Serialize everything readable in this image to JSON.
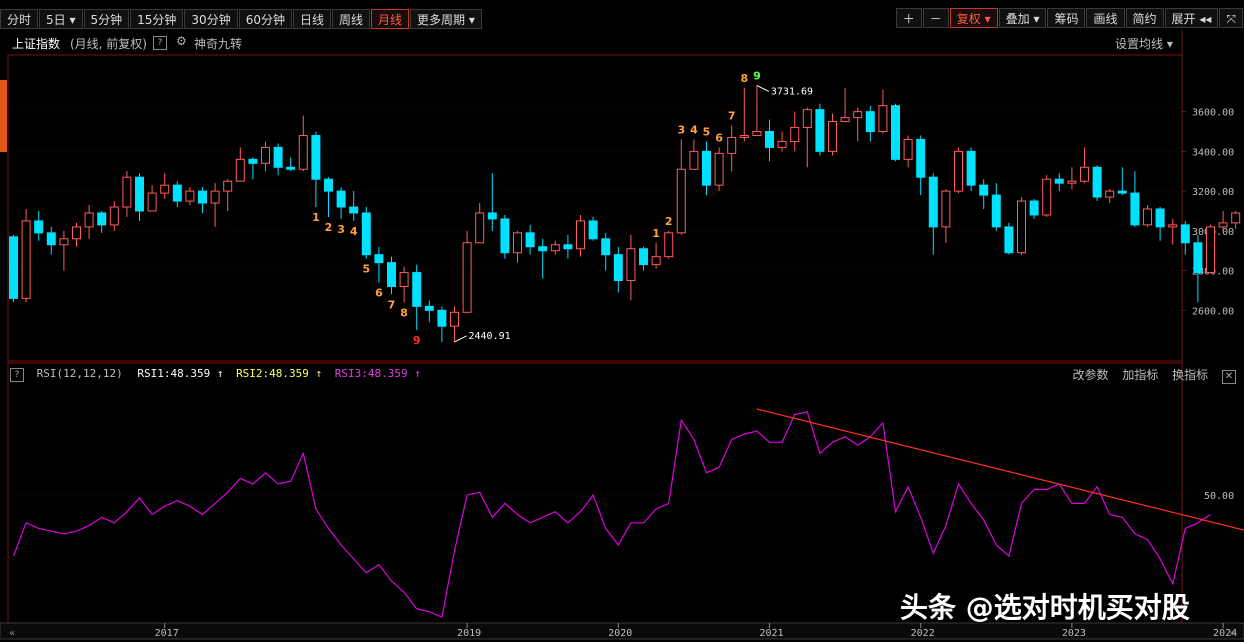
{
  "toolbar": {
    "items": [
      {
        "label": "分时"
      },
      {
        "label": "5日 ▾"
      },
      {
        "label": "5分钟"
      },
      {
        "label": "15分钟"
      },
      {
        "label": "30分钟"
      },
      {
        "label": "60分钟"
      },
      {
        "label": "日线"
      },
      {
        "label": "周线"
      },
      {
        "label": "月线"
      },
      {
        "label": "更多周期 ▾"
      }
    ],
    "active_index": 8,
    "right_items": [
      {
        "label": "＋"
      },
      {
        "label": "－"
      },
      {
        "label": "复权 ▾"
      },
      {
        "label": "叠加 ▾"
      },
      {
        "label": "筹码"
      },
      {
        "label": "画线"
      },
      {
        "label": "简约"
      },
      {
        "label": "展开 ◂◂"
      },
      {
        "label": "⤧"
      }
    ]
  },
  "title": {
    "name": "上证指数",
    "sub": "(月线, 前复权)",
    "indicator": "神奇九转",
    "ma_setting": "设置均线 ▾"
  },
  "rsi": {
    "header": "RSI(12,12,12)",
    "rsi1": "RSI1:48.359 ↑",
    "rsi2": "RSI2:48.359 ↑",
    "rsi3": "RSI3:48.359 ↑",
    "buttons": [
      "改参数",
      "加指标",
      "换指标"
    ],
    "close": "✕",
    "help": "?"
  },
  "colors": {
    "up": "#ff5c5c",
    "down": "#00e0ff",
    "rsi": "#e000e0",
    "trend": "#ff3020",
    "nine": "#ffa040",
    "nine_top": "#60ff60",
    "nine_bottom": "#ff3030"
  },
  "watermark": "头条 @选对时机买对股",
  "chart_data": {
    "type": "candlestick",
    "price_axis": {
      "ticks": [
        2600,
        2800,
        3000,
        3200,
        3400,
        3600
      ],
      "labels": [
        "2600.00",
        "2800.00",
        "3000.00",
        "3200.00",
        "3400.00",
        "3600.00"
      ],
      "range": [
        2360,
        3870
      ]
    },
    "rsi_axis": {
      "ticks": [
        50
      ],
      "labels": [
        "50.00"
      ],
      "range": [
        5,
        90
      ]
    },
    "year_labels": [
      {
        "year": "2017",
        "index": 12
      },
      {
        "year": "2019",
        "index": 36
      },
      {
        "year": "2020",
        "index": 48
      },
      {
        "year": "2021",
        "index": 60
      },
      {
        "year": "2022",
        "index": 72
      },
      {
        "year": "2023",
        "index": 84
      },
      {
        "year": "2024",
        "index": 96
      }
    ],
    "annotations": [
      {
        "text": "3731.69",
        "index": 59,
        "value": 3731.69
      },
      {
        "text": "2440.91",
        "index": 35,
        "value": 2440.91
      }
    ],
    "candles": [
      [
        2970,
        2660,
        2980,
        2640
      ],
      [
        2660,
        3050,
        3110,
        2640
      ],
      [
        3050,
        2990,
        3100,
        2950
      ],
      [
        2990,
        2930,
        3020,
        2880
      ],
      [
        2930,
        2960,
        3000,
        2800
      ],
      [
        2960,
        3020,
        3040,
        2920
      ],
      [
        3020,
        3090,
        3130,
        2960
      ],
      [
        3090,
        3030,
        3100,
        2990
      ],
      [
        3030,
        3120,
        3150,
        3000
      ],
      [
        3120,
        3270,
        3300,
        3070
      ],
      [
        3270,
        3100,
        3290,
        3050
      ],
      [
        3100,
        3190,
        3230,
        3100
      ],
      [
        3190,
        3230,
        3290,
        3160
      ],
      [
        3230,
        3150,
        3250,
        3120
      ],
      [
        3150,
        3200,
        3220,
        3130
      ],
      [
        3200,
        3140,
        3220,
        3090
      ],
      [
        3140,
        3200,
        3240,
        3020
      ],
      [
        3200,
        3250,
        3260,
        3100
      ],
      [
        3250,
        3360,
        3420,
        3250
      ],
      [
        3360,
        3340,
        3370,
        3260
      ],
      [
        3340,
        3420,
        3450,
        3300
      ],
      [
        3420,
        3320,
        3440,
        3280
      ],
      [
        3320,
        3310,
        3370,
        3300
      ],
      [
        3310,
        3480,
        3580,
        3300
      ],
      [
        3480,
        3260,
        3500,
        3120
      ],
      [
        3260,
        3200,
        3270,
        3070
      ],
      [
        3200,
        3120,
        3220,
        3060
      ],
      [
        3120,
        3090,
        3200,
        3050
      ],
      [
        3090,
        2880,
        3120,
        2860
      ],
      [
        2880,
        2840,
        2920,
        2740
      ],
      [
        2840,
        2720,
        2870,
        2680
      ],
      [
        2720,
        2790,
        2820,
        2640
      ],
      [
        2790,
        2620,
        2830,
        2500
      ],
      [
        2620,
        2600,
        2650,
        2540
      ],
      [
        2600,
        2520,
        2620,
        2440
      ],
      [
        2520,
        2590,
        2620,
        2440
      ],
      [
        2590,
        2940,
        3000,
        2590
      ],
      [
        2940,
        3090,
        3140,
        2960
      ],
      [
        3090,
        3060,
        3290,
        3000
      ],
      [
        3060,
        2890,
        3080,
        2860
      ],
      [
        2890,
        2990,
        3000,
        2840
      ],
      [
        2990,
        2920,
        3030,
        2880
      ],
      [
        2920,
        2900,
        2960,
        2760
      ],
      [
        2900,
        2930,
        2950,
        2880
      ],
      [
        2930,
        2910,
        2980,
        2860
      ],
      [
        2910,
        3050,
        3080,
        2870
      ],
      [
        3050,
        2960,
        3070,
        2950
      ],
      [
        2960,
        2880,
        2990,
        2800
      ],
      [
        2880,
        2750,
        2920,
        2690
      ],
      [
        2750,
        2910,
        2980,
        2650
      ],
      [
        2910,
        2830,
        2920,
        2800
      ],
      [
        2830,
        2870,
        2940,
        2810
      ],
      [
        2870,
        2990,
        3000,
        2860
      ],
      [
        2990,
        3310,
        3460,
        2980
      ],
      [
        3310,
        3400,
        3460,
        3320
      ],
      [
        3400,
        3230,
        3450,
        3180
      ],
      [
        3230,
        3390,
        3420,
        3200
      ],
      [
        3390,
        3470,
        3530,
        3300
      ],
      [
        3470,
        3480,
        3720,
        3450
      ],
      [
        3480,
        3500,
        3732,
        3480
      ],
      [
        3500,
        3420,
        3560,
        3350
      ],
      [
        3420,
        3450,
        3500,
        3400
      ],
      [
        3450,
        3520,
        3600,
        3400
      ],
      [
        3520,
        3610,
        3620,
        3320
      ],
      [
        3610,
        3400,
        3640,
        3380
      ],
      [
        3400,
        3550,
        3590,
        3380
      ],
      [
        3550,
        3570,
        3720,
        3550
      ],
      [
        3570,
        3600,
        3620,
        3450
      ],
      [
        3600,
        3500,
        3630,
        3450
      ],
      [
        3500,
        3630,
        3710,
        3490
      ],
      [
        3630,
        3360,
        3640,
        3350
      ],
      [
        3360,
        3460,
        3480,
        3320
      ],
      [
        3460,
        3270,
        3480,
        3180
      ],
      [
        3270,
        3020,
        3290,
        2880
      ],
      [
        3020,
        3200,
        3210,
        2940
      ],
      [
        3200,
        3400,
        3420,
        3190
      ],
      [
        3400,
        3230,
        3420,
        3200
      ],
      [
        3230,
        3180,
        3260,
        3110
      ],
      [
        3180,
        3020,
        3240,
        3000
      ],
      [
        3020,
        2890,
        3040,
        2880
      ],
      [
        2890,
        3150,
        3170,
        2880
      ],
      [
        3150,
        3080,
        3160,
        3060
      ],
      [
        3080,
        3260,
        3280,
        3070
      ],
      [
        3260,
        3240,
        3290,
        3200
      ],
      [
        3240,
        3250,
        3320,
        3210
      ],
      [
        3250,
        3320,
        3420,
        3240
      ],
      [
        3320,
        3170,
        3330,
        3150
      ],
      [
        3170,
        3200,
        3210,
        3140
      ],
      [
        3200,
        3190,
        3320,
        3180
      ],
      [
        3190,
        3030,
        3300,
        3020
      ],
      [
        3030,
        3110,
        3130,
        3020
      ],
      [
        3110,
        3020,
        3120,
        2950
      ],
      [
        3020,
        3030,
        3060,
        2930
      ],
      [
        3030,
        2940,
        3050,
        2880
      ],
      [
        2940,
        2790,
        2980,
        2640
      ],
      [
        2790,
        3020,
        3030,
        2790
      ],
      [
        3020,
        3040,
        3100,
        3000
      ],
      [
        3040,
        3090,
        3100,
        3010
      ]
    ],
    "nine_turn": [
      {
        "text": "1",
        "index": 24,
        "pos": "below",
        "color": "nine"
      },
      {
        "text": "2",
        "index": 25,
        "pos": "below",
        "color": "nine"
      },
      {
        "text": "3",
        "index": 26,
        "pos": "below",
        "color": "nine"
      },
      {
        "text": "4",
        "index": 27,
        "pos": "below",
        "color": "nine"
      },
      {
        "text": "5",
        "index": 28,
        "pos": "below",
        "color": "nine"
      },
      {
        "text": "6",
        "index": 29,
        "pos": "below",
        "color": "nine"
      },
      {
        "text": "7",
        "index": 30,
        "pos": "below",
        "color": "nine"
      },
      {
        "text": "8",
        "index": 31,
        "pos": "below",
        "color": "nine"
      },
      {
        "text": "9",
        "index": 32,
        "pos": "below",
        "color": "nine_bottom"
      },
      {
        "text": "1",
        "index": 51,
        "pos": "above",
        "color": "nine"
      },
      {
        "text": "2",
        "index": 52,
        "pos": "above",
        "color": "nine"
      },
      {
        "text": "3",
        "index": 53,
        "pos": "above",
        "color": "nine"
      },
      {
        "text": "4",
        "index": 54,
        "pos": "above",
        "color": "nine"
      },
      {
        "text": "5",
        "index": 55,
        "pos": "above",
        "color": "nine"
      },
      {
        "text": "6",
        "index": 56,
        "pos": "above",
        "color": "nine"
      },
      {
        "text": "7",
        "index": 57,
        "pos": "above",
        "color": "nine"
      },
      {
        "text": "8",
        "index": 58,
        "pos": "above",
        "color": "nine"
      },
      {
        "text": "9",
        "index": 59,
        "pos": "above",
        "color": "nine_top"
      }
    ],
    "rsi_values": [
      28,
      40,
      38,
      37,
      36,
      37,
      39,
      42,
      40,
      44,
      49,
      43,
      46,
      48,
      46,
      43,
      47,
      51,
      56,
      54,
      58,
      54,
      55,
      65,
      45,
      38,
      32,
      27,
      22,
      25,
      19,
      15,
      9,
      8,
      6,
      30,
      50,
      51,
      42,
      47,
      43,
      40,
      42,
      44,
      40,
      44,
      50,
      38,
      32,
      40,
      40,
      45,
      47,
      77,
      70,
      58,
      60,
      70,
      72,
      73,
      69,
      69,
      79,
      80,
      65,
      69,
      71,
      68,
      71,
      76,
      44,
      53,
      42,
      29,
      39,
      54,
      47,
      41,
      32,
      28,
      47,
      52,
      52,
      54,
      47,
      47,
      53,
      43,
      42,
      36,
      34,
      27,
      18,
      38,
      40,
      43
    ],
    "rsi_trend_line": {
      "from": [
        59,
        81
      ],
      "to": [
        98,
        37
      ]
    }
  }
}
